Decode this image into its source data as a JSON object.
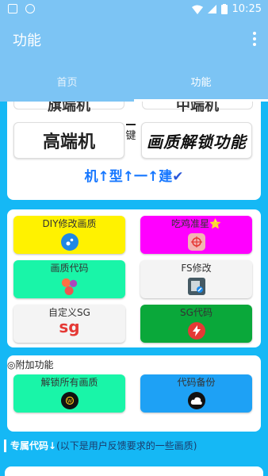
{
  "status": {
    "time": "10:25"
  },
  "appbar": {
    "title": "功能"
  },
  "tabs": [
    {
      "label": "首页"
    },
    {
      "label": "功能"
    }
  ],
  "device": {
    "peek_left": "旗端机",
    "peek_right": "中端机",
    "high_end": "高端机",
    "unlock": "画质解锁功能",
    "side_char": "键",
    "slogan": "机↑型↑一↑建",
    "slogan_check": "✔"
  },
  "features": [
    {
      "label": "DIY修改画质",
      "bg": "#fff200",
      "icon": "bubbles-icon"
    },
    {
      "label": "吃鸡准星⭐",
      "bg": "#ff00ff",
      "icon": "crosshair-icon"
    },
    {
      "label": "画质代码",
      "bg": "#19f5a8",
      "icon": "dots-icon"
    },
    {
      "label": "FS修改",
      "bg": "#f4f4f4",
      "icon": "edit-file-icon"
    },
    {
      "label": "自定义SG",
      "bg": "#f4f4f4",
      "icon": "sg-icon",
      "icon_text": "sg"
    },
    {
      "label": "SG代码",
      "bg": "#0aa83a",
      "icon": "flash-icon"
    }
  ],
  "addons": {
    "title": "◎附加功能",
    "unlock_all": "解锁所有画质",
    "backup": "代码备份"
  },
  "exclusive": {
    "title": "专属代码↓",
    "subtitle": "(以下是用户反馈要求的一些画质)"
  },
  "colors": {
    "accent": "#15b8f5",
    "appbar": "#7cc4f4",
    "slogan": "#1677ff"
  }
}
